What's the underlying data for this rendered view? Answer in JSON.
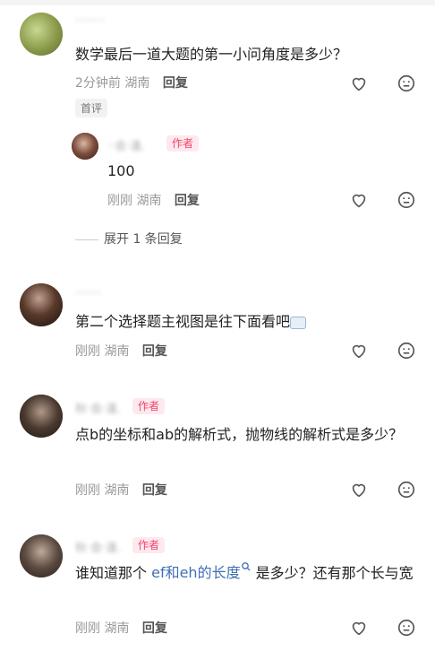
{
  "comments": [
    {
      "text": "数学最后一道大题的第一小问角度是多少？",
      "time": "2分钟前",
      "location": "湖南",
      "reply": "回复",
      "badge": "首评",
      "username": "········",
      "avatar_color": "#8a9a4a"
    },
    {
      "username": "··会·逢.",
      "author_tag": "作者",
      "text": "100",
      "time": "刚刚",
      "location": "湖南",
      "reply": "回复",
      "avatar_color": "#5a3a2a"
    },
    {
      "username": "·······",
      "text": "第二个选择题主视图是往下面看吧",
      "time": "刚刚",
      "location": "湖南",
      "reply": "回复",
      "avatar_color": "#3a2a20"
    },
    {
      "username": "秋·会·逢.",
      "author_tag": "作者",
      "text": "点b的坐标和ab的解析式，抛物线的解析式是多少？",
      "time": "刚刚",
      "location": "湖南",
      "reply": "回复",
      "avatar_color": "#4a3a30"
    },
    {
      "username": "秋·会·逢.",
      "author_tag": "作者",
      "text_before": "谁知道那个",
      "text_link": "ef和eh的长度",
      "text_after": "是多少？还有那个长与宽",
      "time": "刚刚",
      "location": "湖南",
      "reply": "回复",
      "avatar_color": "#5a4a40"
    }
  ],
  "expand_replies": "展开 1 条回复",
  "icons": {
    "like": "heart-icon",
    "dislike": "unhappy-face-icon"
  }
}
